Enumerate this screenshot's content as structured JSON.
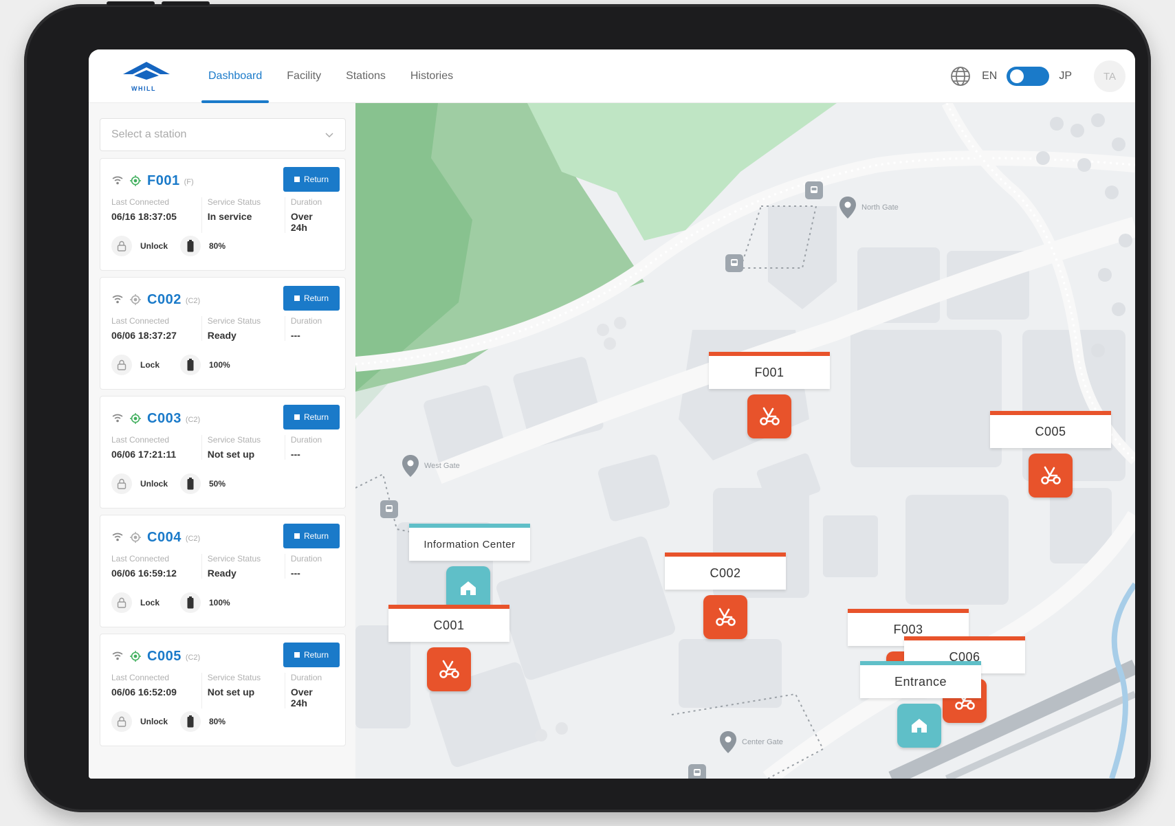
{
  "app": {
    "logo_text": "WHILL",
    "nav": [
      {
        "label": "Dashboard",
        "active": true
      },
      {
        "label": "Facility",
        "active": false
      },
      {
        "label": "Stations",
        "active": false
      },
      {
        "label": "Histories",
        "active": false
      }
    ],
    "lang_left": "EN",
    "lang_right": "JP",
    "avatar": "TA"
  },
  "sidebar": {
    "select_placeholder": "Select a station",
    "labels": {
      "last_connected": "Last Connected",
      "service_status": "Service Status",
      "duration": "Duration",
      "return": "Return"
    },
    "cards": [
      {
        "id": "F001",
        "type": "(F)",
        "last": "06/16 18:37:05",
        "status": "In service",
        "duration": "Over 24h",
        "lock": "Unlock",
        "battery": "80%",
        "gps_active": true
      },
      {
        "id": "C002",
        "type": "(C2)",
        "last": "06/06 18:37:27",
        "status": "Ready",
        "duration": "---",
        "lock": "Lock",
        "battery": "100%",
        "gps_active": false
      },
      {
        "id": "C003",
        "type": "(C2)",
        "last": "06/06 17:21:11",
        "status": "Not set up",
        "duration": "---",
        "lock": "Unlock",
        "battery": "50%",
        "gps_active": true
      },
      {
        "id": "C004",
        "type": "(C2)",
        "last": "06/06 16:59:12",
        "status": "Ready",
        "duration": "---",
        "lock": "Lock",
        "battery": "100%",
        "gps_active": false
      },
      {
        "id": "C005",
        "type": "(C2)",
        "last": "06/06 16:52:09",
        "status": "Not set up",
        "duration": "Over 24h",
        "lock": "Unlock",
        "battery": "80%",
        "gps_active": true
      }
    ]
  },
  "map": {
    "gates": {
      "north": "North Gate",
      "west": "West Gate",
      "center": "Center Gate"
    },
    "markers": [
      {
        "label": "F001",
        "kind": "vehicle"
      },
      {
        "label": "C005",
        "kind": "vehicle"
      },
      {
        "label": "Information Center",
        "kind": "place"
      },
      {
        "label": "C002",
        "kind": "vehicle"
      },
      {
        "label": "C001",
        "kind": "vehicle"
      },
      {
        "label": "F003",
        "kind": "vehicle"
      },
      {
        "label": "C006",
        "kind": "vehicle"
      },
      {
        "label": "Entrance",
        "kind": "place"
      }
    ]
  },
  "colors": {
    "accent": "#1a7ac9",
    "vehicle": "#e8532b",
    "place": "#5fbfc8",
    "gps_active": "#3fae5c"
  }
}
